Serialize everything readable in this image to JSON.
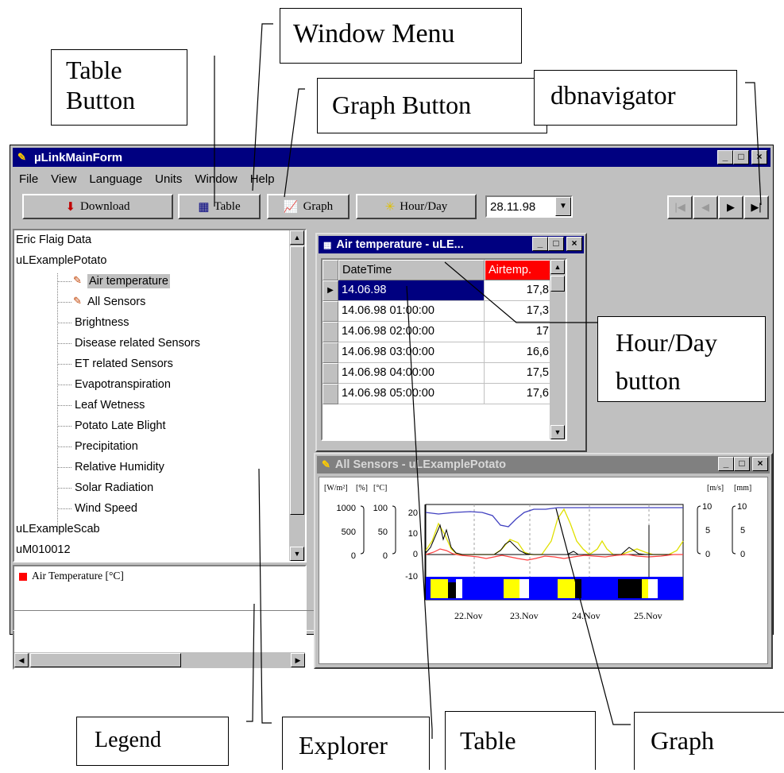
{
  "window": {
    "title": "µLinkMainForm",
    "caption_buttons": [
      "_",
      "□",
      "×"
    ]
  },
  "menu": [
    "File",
    "View",
    "Language",
    "Units",
    "Window",
    "Help"
  ],
  "toolbar": {
    "download_label": "Download",
    "table_label": "Table",
    "graph_label": "Graph",
    "hourday_label": "Hour/Day",
    "date_value": "28.11.98"
  },
  "explorer": {
    "items": [
      {
        "label": "Eric Flaig Data",
        "level": 0
      },
      {
        "label": "uLExamplePotato",
        "level": 0
      },
      {
        "label": "Air temperature",
        "level": 1,
        "icon": "sensor-icon",
        "selected": true
      },
      {
        "label": "All Sensors",
        "level": 1,
        "icon": "sensor-icon"
      },
      {
        "label": "Brightness",
        "level": 1
      },
      {
        "label": "Disease related Sensors",
        "level": 1
      },
      {
        "label": "ET related Sensors",
        "level": 1
      },
      {
        "label": "Evapotranspiration",
        "level": 1
      },
      {
        "label": "Leaf Wetness",
        "level": 1
      },
      {
        "label": "Potato Late Blight",
        "level": 1
      },
      {
        "label": "Precipitation",
        "level": 1
      },
      {
        "label": "Relative Humidity",
        "level": 1
      },
      {
        "label": "Solar Radiation",
        "level": 1
      },
      {
        "label": "Wind Speed",
        "level": 1
      },
      {
        "label": "uLExampleScab",
        "level": 0
      },
      {
        "label": "uM010012",
        "level": 0
      }
    ]
  },
  "legend": {
    "items": [
      {
        "label": "Air Temperature [°C]",
        "color": "#ff0000"
      }
    ]
  },
  "table_window": {
    "title": "Air temperature - uLE...",
    "columns": [
      "DateTime",
      "Airtemp."
    ],
    "rows": [
      [
        "14.06.98",
        "17,8"
      ],
      [
        "14.06.98 01:00:00",
        "17,3"
      ],
      [
        "14.06.98 02:00:00",
        "17"
      ],
      [
        "14.06.98 03:00:00",
        "16,6"
      ],
      [
        "14.06.98 04:00:00",
        "17,5"
      ],
      [
        "14.06.98 05:00:00",
        "17,6"
      ]
    ]
  },
  "graph_window": {
    "title": "All Sensors - uLExamplePotato",
    "unit_labels_left": [
      "[W/m²]",
      "[%]",
      "[°C]"
    ],
    "unit_labels_right": [
      "[m/s]",
      "[mm]"
    ],
    "axis1_ticks": [
      "1000",
      "500",
      "0"
    ],
    "axis2_ticks": [
      "100",
      "50",
      "0"
    ],
    "axis3_ticks": [
      "20",
      "10",
      "0",
      "-10"
    ],
    "axis4_ticks": [
      "10",
      "5",
      "0"
    ],
    "axis5_ticks": [
      "10",
      "5",
      "0"
    ],
    "x_ticks": [
      "22.Nov",
      "23.Nov",
      "24.Nov",
      "25.Nov"
    ]
  },
  "callouts": {
    "table_button": "Table\nButton",
    "window_menu": "Window Menu",
    "graph_button": "Graph Button",
    "dbnavigator": "dbnavigator",
    "hourday_button": "Hour/Day\nbutton",
    "legend": "Legend",
    "explorer": "Explorer",
    "table": "Table",
    "graph": "Graph"
  },
  "colors": {
    "titlebar_active": "#000080",
    "titlebar_inactive": "#808080",
    "selection": "#000080",
    "airtemp_header": "#ff0000"
  }
}
